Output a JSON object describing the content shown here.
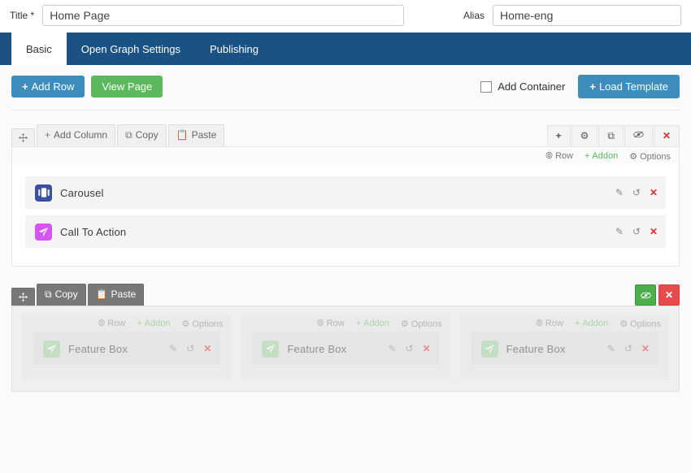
{
  "form": {
    "title_label": "Title *",
    "title_value": "Home Page",
    "title_placeholder": "Title",
    "alias_label": "Alias",
    "alias_value": "Home-eng",
    "alias_placeholder": "Alias"
  },
  "tabs": [
    {
      "label": "Basic",
      "active": true
    },
    {
      "label": "Open Graph Settings",
      "active": false
    },
    {
      "label": "Publishing",
      "active": false
    }
  ],
  "toolbar": {
    "add_row": "Add Row",
    "add_row_icon": "plus-icon",
    "view_page": "View Page",
    "add_container": "Add Container",
    "load_template": "Load Template",
    "load_template_icon": "plus-icon"
  },
  "row_meta": {
    "row": "Row",
    "row_icon": "circle-plus-icon",
    "addon": "Addon",
    "addon_icon": "plus-icon",
    "options": "Options",
    "options_icon": "gear-icon"
  },
  "row_actions": {
    "edit_icon": "pencil-icon",
    "reload_icon": "refresh-icon",
    "delete_icon": "close-icon"
  },
  "rows": [
    {
      "name": "row-one",
      "head_buttons": [
        {
          "label": "",
          "icon": "move-icon",
          "name": "drag-handle"
        },
        {
          "label": "Add Column",
          "icon": "plus-icon",
          "name": "add-column-button"
        },
        {
          "label": "Copy",
          "icon": "copy-icon",
          "name": "copy-button"
        },
        {
          "label": "Paste",
          "icon": "paste-icon",
          "name": "paste-button"
        }
      ],
      "head_icons": [
        {
          "icon": "plus-icon",
          "name": "row-add-icon"
        },
        {
          "icon": "gear-icon",
          "name": "row-settings-icon"
        },
        {
          "icon": "duplicate-icon",
          "name": "row-duplicate-icon"
        },
        {
          "icon": "eye-slash-icon",
          "name": "row-visibility-icon"
        },
        {
          "icon": "close-icon",
          "name": "row-delete-icon"
        }
      ],
      "widgets": [
        {
          "label": "Carousel",
          "icon": "carousel-icon",
          "color": "#3b4fa0"
        },
        {
          "label": "Call To Action",
          "icon": "paper-plane-icon",
          "color": "#d455f0"
        }
      ]
    },
    {
      "name": "row-two",
      "head_buttons": [
        {
          "label": "",
          "icon": "move-icon",
          "name": "drag-handle"
        },
        {
          "label": "Copy",
          "icon": "copy-icon",
          "name": "copy-button"
        },
        {
          "label": "Paste",
          "icon": "paste-icon",
          "name": "paste-button"
        }
      ],
      "head_squares": [
        {
          "icon": "eye-slash-icon",
          "name": "row-visibility-button",
          "color": "#4cae4c"
        },
        {
          "icon": "close-icon",
          "name": "row-delete-button",
          "color": "#e64b4b"
        }
      ],
      "columns": [
        {
          "widget": {
            "label": "Feature Box",
            "icon": "paper-plane-icon",
            "color": "#9fd49f"
          }
        },
        {
          "widget": {
            "label": "Feature Box",
            "icon": "paper-plane-icon",
            "color": "#9fd49f"
          }
        },
        {
          "widget": {
            "label": "Feature Box",
            "icon": "paper-plane-icon",
            "color": "#9fd49f"
          }
        }
      ]
    }
  ],
  "colors": {
    "tab_bar": "#1b5183",
    "primary_button": "#3c8dbc",
    "success_button": "#5cb85c",
    "danger": "#e03131"
  }
}
